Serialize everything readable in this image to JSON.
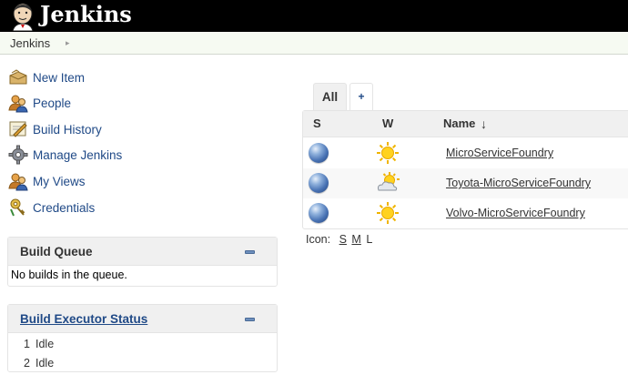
{
  "header": {
    "title": "Jenkins"
  },
  "breadcrumb": {
    "home": "Jenkins",
    "arrow": "▸"
  },
  "tasks": [
    {
      "label": "New Item",
      "icon": "new-item-icon"
    },
    {
      "label": "People",
      "icon": "people-icon"
    },
    {
      "label": "Build History",
      "icon": "build-history-icon"
    },
    {
      "label": "Manage Jenkins",
      "icon": "gear-icon"
    },
    {
      "label": "My Views",
      "icon": "my-views-icon"
    },
    {
      "label": "Credentials",
      "icon": "credentials-key-icon"
    }
  ],
  "build_queue": {
    "title": "Build Queue",
    "empty_text": "No builds in the queue."
  },
  "executors": {
    "title": "Build Executor Status",
    "rows": [
      {
        "num": "1",
        "status": "Idle"
      },
      {
        "num": "2",
        "status": "Idle"
      }
    ]
  },
  "tabs": [
    {
      "label": "All"
    },
    {
      "label": "+"
    }
  ],
  "table": {
    "columns": {
      "status": "S",
      "weather": "W",
      "name": "Name",
      "sort_arrow": "↓"
    },
    "rows": [
      {
        "name": "MicroServiceFoundry",
        "status": "blue-ball",
        "weather": "sunny"
      },
      {
        "name": "Toyota-MicroServiceFoundry",
        "status": "blue-ball",
        "weather": "partly-cloudy"
      },
      {
        "name": "Volvo-MicroServiceFoundry",
        "status": "blue-ball",
        "weather": "sunny"
      }
    ]
  },
  "icon_size": {
    "label": "Icon:",
    "small": "S",
    "medium": "M",
    "large": "L"
  },
  "colors": {
    "link": "#204a87",
    "header_bg": "#000000",
    "pane_bg": "#f0f0f0",
    "breadcrumb_bg": "#f6faf2"
  }
}
